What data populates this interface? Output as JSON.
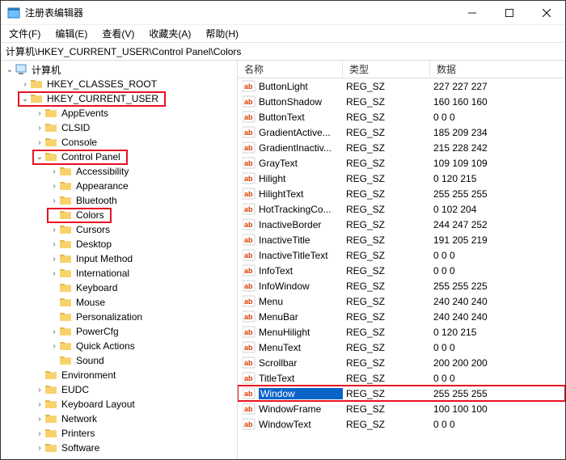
{
  "window": {
    "title": "注册表编辑器"
  },
  "menu": {
    "file": "文件(F)",
    "edit": "编辑(E)",
    "view": "查看(V)",
    "favorites": "收藏夹(A)",
    "help": "帮助(H)"
  },
  "address": "计算机\\HKEY_CURRENT_USER\\Control Panel\\Colors",
  "list_headers": {
    "name": "名称",
    "type": "类型",
    "data": "数据"
  },
  "tree": {
    "root": "计算机",
    "items": [
      {
        "label": "HKEY_CLASSES_ROOT",
        "depth": 1,
        "exp": ">",
        "hl": false
      },
      {
        "label": "HKEY_CURRENT_USER",
        "depth": 1,
        "exp": "v",
        "hl": true
      },
      {
        "label": "AppEvents",
        "depth": 2,
        "exp": ">",
        "hl": false
      },
      {
        "label": "CLSID",
        "depth": 2,
        "exp": ">",
        "hl": false
      },
      {
        "label": "Console",
        "depth": 2,
        "exp": ">",
        "hl": false
      },
      {
        "label": "Control Panel",
        "depth": 2,
        "exp": "v",
        "hl": true
      },
      {
        "label": "Accessibility",
        "depth": 3,
        "exp": ">",
        "hl": false
      },
      {
        "label": "Appearance",
        "depth": 3,
        "exp": ">",
        "hl": false
      },
      {
        "label": "Bluetooth",
        "depth": 3,
        "exp": ">",
        "hl": false
      },
      {
        "label": "Colors",
        "depth": 3,
        "exp": " ",
        "hl": true
      },
      {
        "label": "Cursors",
        "depth": 3,
        "exp": ">",
        "hl": false
      },
      {
        "label": "Desktop",
        "depth": 3,
        "exp": ">",
        "hl": false
      },
      {
        "label": "Input Method",
        "depth": 3,
        "exp": ">",
        "hl": false
      },
      {
        "label": "International",
        "depth": 3,
        "exp": ">",
        "hl": false
      },
      {
        "label": "Keyboard",
        "depth": 3,
        "exp": " ",
        "hl": false
      },
      {
        "label": "Mouse",
        "depth": 3,
        "exp": " ",
        "hl": false
      },
      {
        "label": "Personalization",
        "depth": 3,
        "exp": " ",
        "hl": false
      },
      {
        "label": "PowerCfg",
        "depth": 3,
        "exp": ">",
        "hl": false
      },
      {
        "label": "Quick Actions",
        "depth": 3,
        "exp": ">",
        "hl": false
      },
      {
        "label": "Sound",
        "depth": 3,
        "exp": " ",
        "hl": false
      },
      {
        "label": "Environment",
        "depth": 2,
        "exp": " ",
        "hl": false
      },
      {
        "label": "EUDC",
        "depth": 2,
        "exp": ">",
        "hl": false
      },
      {
        "label": "Keyboard Layout",
        "depth": 2,
        "exp": ">",
        "hl": false
      },
      {
        "label": "Network",
        "depth": 2,
        "exp": ">",
        "hl": false
      },
      {
        "label": "Printers",
        "depth": 2,
        "exp": ">",
        "hl": false
      },
      {
        "label": "Software",
        "depth": 2,
        "exp": ">",
        "hl": false
      }
    ]
  },
  "values": [
    {
      "name": "ButtonLight",
      "type": "REG_SZ",
      "data": "227 227 227"
    },
    {
      "name": "ButtonShadow",
      "type": "REG_SZ",
      "data": "160 160 160"
    },
    {
      "name": "ButtonText",
      "type": "REG_SZ",
      "data": "0 0 0"
    },
    {
      "name": "GradientActive...",
      "type": "REG_SZ",
      "data": "185 209 234"
    },
    {
      "name": "GradientInactiv...",
      "type": "REG_SZ",
      "data": "215 228 242"
    },
    {
      "name": "GrayText",
      "type": "REG_SZ",
      "data": "109 109 109"
    },
    {
      "name": "Hilight",
      "type": "REG_SZ",
      "data": "0 120 215"
    },
    {
      "name": "HilightText",
      "type": "REG_SZ",
      "data": "255 255 255"
    },
    {
      "name": "HotTrackingCo...",
      "type": "REG_SZ",
      "data": "0 102 204"
    },
    {
      "name": "InactiveBorder",
      "type": "REG_SZ",
      "data": "244 247 252"
    },
    {
      "name": "InactiveTitle",
      "type": "REG_SZ",
      "data": "191 205 219"
    },
    {
      "name": "InactiveTitleText",
      "type": "REG_SZ",
      "data": "0 0 0"
    },
    {
      "name": "InfoText",
      "type": "REG_SZ",
      "data": "0 0 0"
    },
    {
      "name": "InfoWindow",
      "type": "REG_SZ",
      "data": "255 255 225"
    },
    {
      "name": "Menu",
      "type": "REG_SZ",
      "data": "240 240 240"
    },
    {
      "name": "MenuBar",
      "type": "REG_SZ",
      "data": "240 240 240"
    },
    {
      "name": "MenuHilight",
      "type": "REG_SZ",
      "data": "0 120 215"
    },
    {
      "name": "MenuText",
      "type": "REG_SZ",
      "data": "0 0 0"
    },
    {
      "name": "Scrollbar",
      "type": "REG_SZ",
      "data": "200 200 200"
    },
    {
      "name": "TitleText",
      "type": "REG_SZ",
      "data": "0 0 0"
    },
    {
      "name": "Window",
      "type": "REG_SZ",
      "data": "255 255 255",
      "selected": true,
      "hl": true
    },
    {
      "name": "WindowFrame",
      "type": "REG_SZ",
      "data": "100 100 100"
    },
    {
      "name": "WindowText",
      "type": "REG_SZ",
      "data": "0 0 0"
    }
  ]
}
